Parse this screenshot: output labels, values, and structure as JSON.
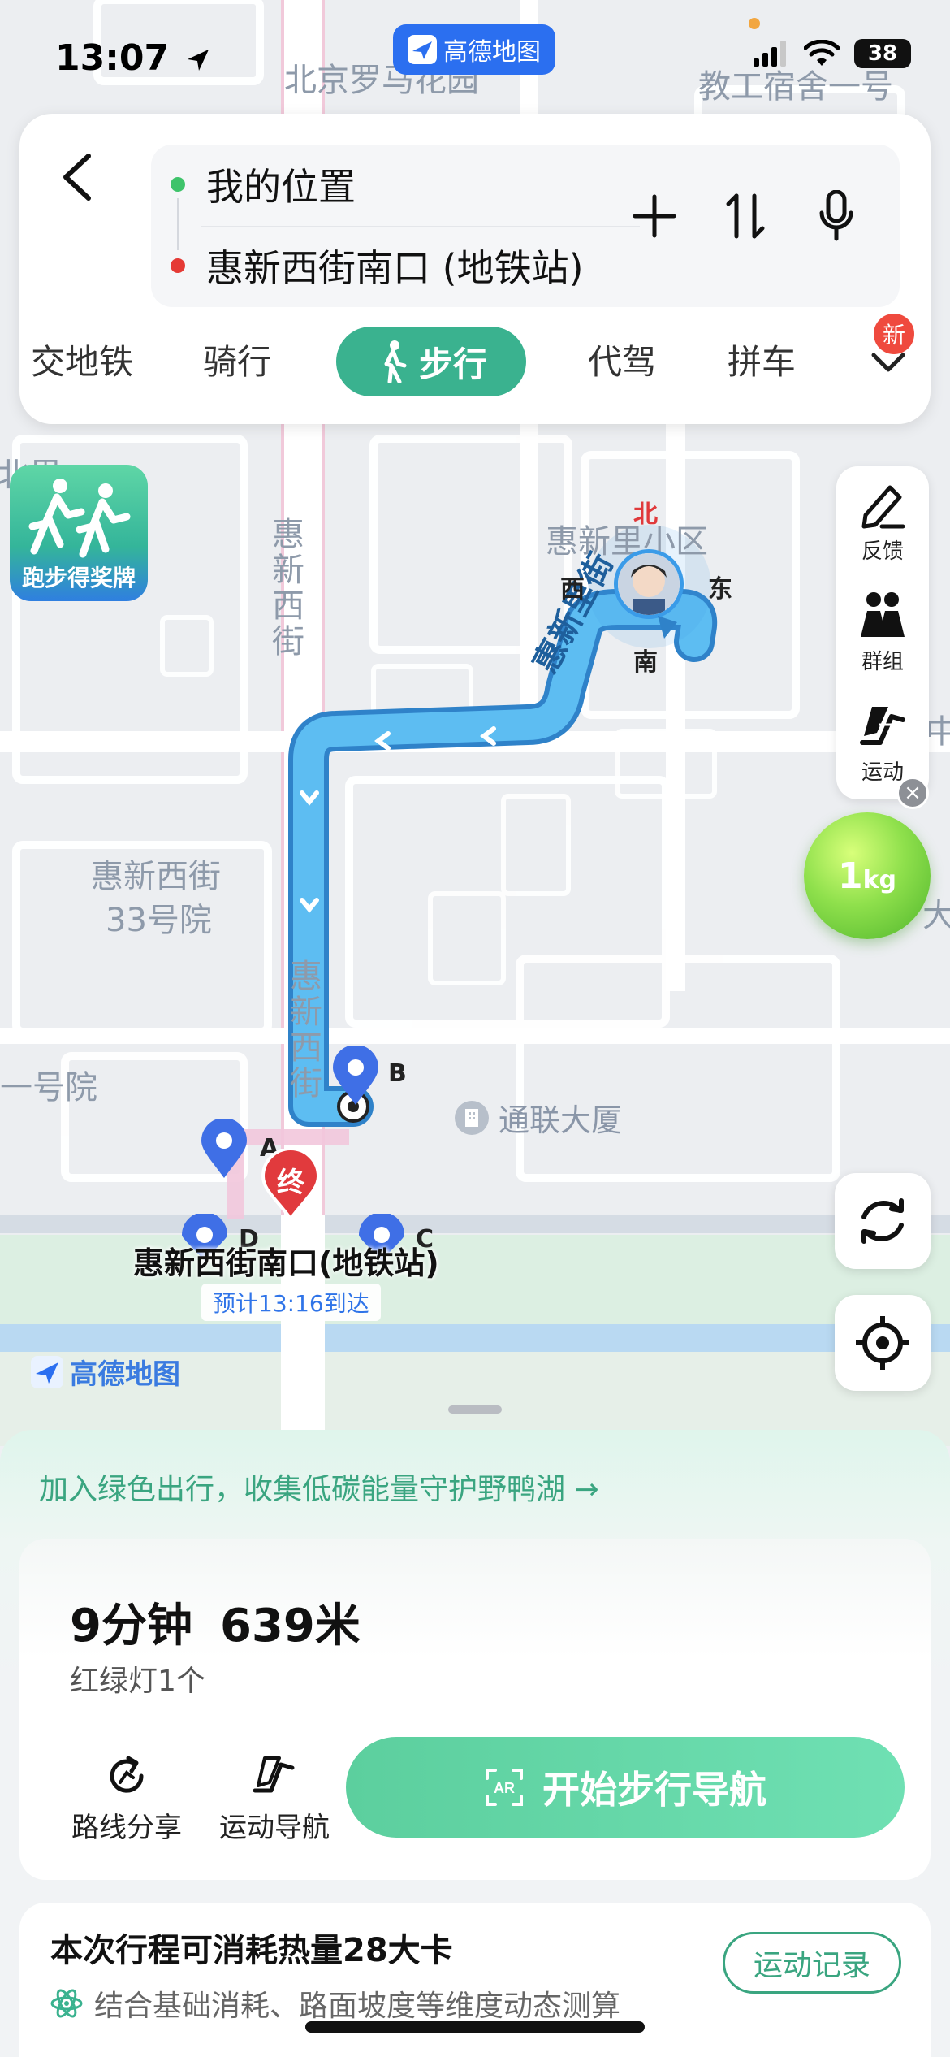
{
  "status_bar": {
    "time": "13:07",
    "battery": "38",
    "app_badge": "高德地图"
  },
  "route": {
    "from": "我的位置",
    "to": "惠新西街南口 (地铁站)"
  },
  "modes": [
    {
      "label": "交地铁"
    },
    {
      "label": "骑行"
    },
    {
      "label": "步行",
      "active": true
    },
    {
      "label": "代驾"
    },
    {
      "label": "拼车"
    }
  ],
  "mode_more_badge": "新",
  "promo": {
    "text": "跑步得奖牌"
  },
  "tools": [
    {
      "label": "反馈",
      "icon": "feedback-pen-icon"
    },
    {
      "label": "群组",
      "icon": "group-icon"
    },
    {
      "label": "运动",
      "icon": "sport-run-icon"
    }
  ],
  "tools_close": "×",
  "energy": {
    "value": "1",
    "unit": "kg"
  },
  "map": {
    "labels": {
      "beijing_garden": "北京罗马花园",
      "jiaogong": "教工宿舍一号",
      "beiyuan": "北里",
      "huixin_xiaoqu": "惠新里小区",
      "huixin_xijie_north": "惠新西街",
      "huixin_xijie_south": "惠新西街",
      "huixin_33": "惠新西街",
      "huixin_33_b": "33号院",
      "yihaoyuan": "一号院",
      "tonglian": "通联大厦",
      "huixinli_jie": "惠新里街",
      "right_big": "大",
      "right_zhong": "中"
    },
    "compass": {
      "north": "北",
      "west": "西",
      "east": "东",
      "south": "南"
    },
    "pins": [
      "A",
      "B",
      "C",
      "D"
    ],
    "end_marker": "终",
    "destination": "惠新西街南口(地铁站)",
    "eta": "预计13:16到达",
    "watermark": "高德地图"
  },
  "sheet": {
    "banner": "加入绿色出行，收集低碳能量守护野鸭湖 →",
    "duration": "9分钟",
    "distance": "639米",
    "traffic_lights": "红绿灯1个",
    "share_label": "路线分享",
    "sport_nav_label": "运动导航",
    "start_label": "开始步行导航",
    "calorie_title": "本次行程可消耗热量28大卡",
    "calorie_sub": "结合基础消耗、路面坡度等维度动态测算",
    "record_label": "运动记录"
  },
  "colors": {
    "route": "#3a9be8",
    "accent_green": "#3ab28f",
    "start_btn": "#5ccf9e",
    "pin_blue": "#3f6fe6",
    "end_red": "#e13a3d"
  }
}
